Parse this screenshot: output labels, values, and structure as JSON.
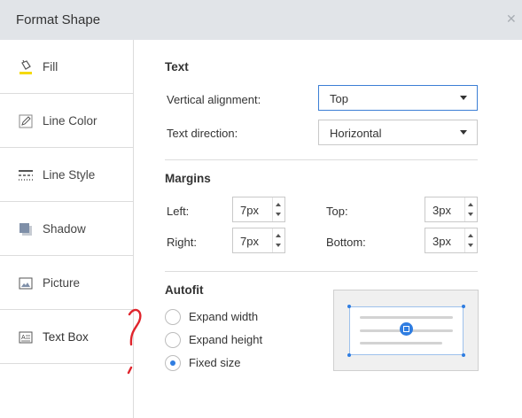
{
  "dialog": {
    "title": "Format Shape"
  },
  "sidebar": {
    "items": [
      {
        "label": "Fill",
        "icon": "fill-bucket-icon"
      },
      {
        "label": "Line Color",
        "icon": "pencil-icon"
      },
      {
        "label": "Line Style",
        "icon": "line-style-icon"
      },
      {
        "label": "Shadow",
        "icon": "shadow-icon"
      },
      {
        "label": "Picture",
        "icon": "picture-icon"
      },
      {
        "label": "Text Box",
        "icon": "text-box-icon"
      }
    ],
    "active": "Text Box"
  },
  "text_section": {
    "title": "Text",
    "vertical_alignment_label": "Vertical alignment:",
    "vertical_alignment_value": "Top",
    "text_direction_label": "Text direction:",
    "text_direction_value": "Horizontal"
  },
  "margins": {
    "title": "Margins",
    "left_label": "Left:",
    "left_value": "7px",
    "top_label": "Top:",
    "top_value": "3px",
    "right_label": "Right:",
    "right_value": "7px",
    "bottom_label": "Bottom:",
    "bottom_value": "3px"
  },
  "autofit": {
    "title": "Autofit",
    "options": [
      {
        "label": "Expand width",
        "checked": false
      },
      {
        "label": "Expand height",
        "checked": false
      },
      {
        "label": "Fixed size",
        "checked": true
      }
    ]
  },
  "colors": {
    "accent": "#2f7de1",
    "annotation": "#e0242c",
    "fill_icon_underline": "#f5d90a"
  }
}
